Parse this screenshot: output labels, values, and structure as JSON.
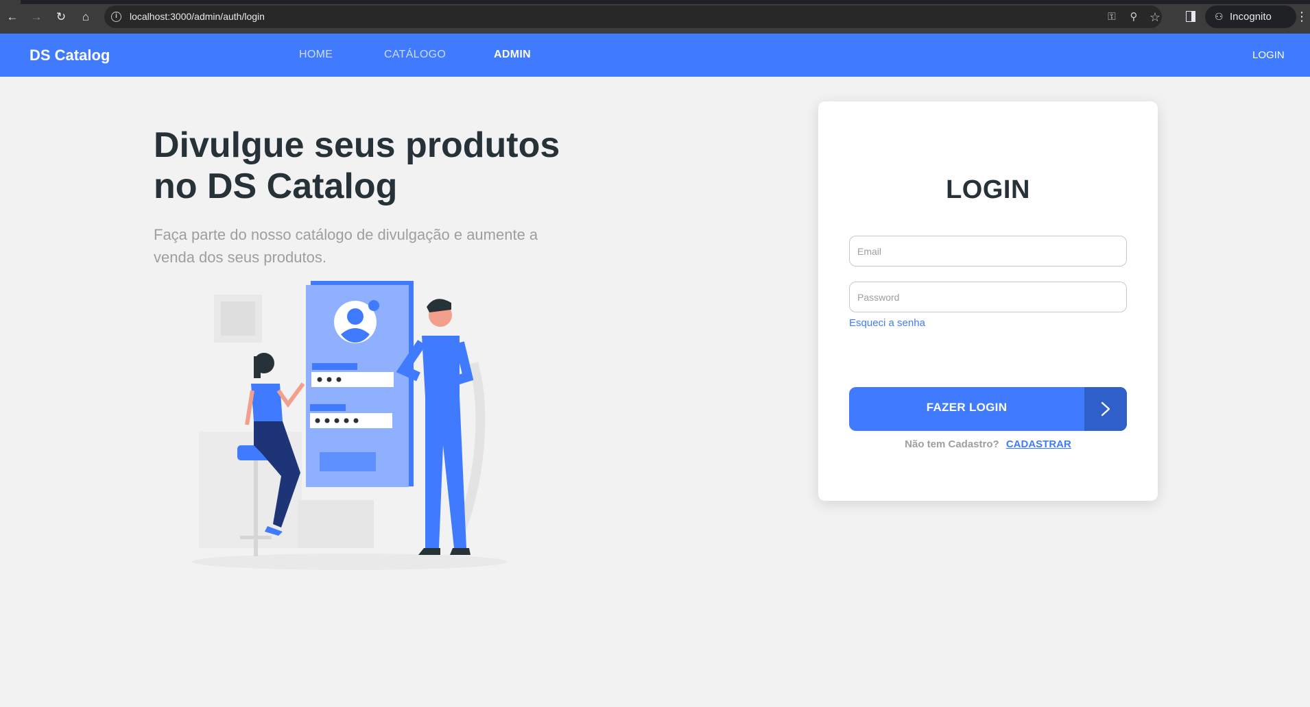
{
  "browser": {
    "url": "localhost:3000/admin/auth/login",
    "incognito_label": "Incognito",
    "icons": [
      "back-icon",
      "forward-icon",
      "reload-icon",
      "home-icon",
      "info-icon",
      "key-icon",
      "zoom-icon",
      "star-icon",
      "side-panel-icon",
      "incognito-icon",
      "menu-icon"
    ]
  },
  "navbar": {
    "brand": "DS Catalog",
    "links": [
      {
        "label": "HOME",
        "active": false
      },
      {
        "label": "CATÁLOGO",
        "active": false
      },
      {
        "label": "ADMIN",
        "active": true
      }
    ],
    "login": "LOGIN",
    "color": "#407bff"
  },
  "hero": {
    "title": "Divulgue seus produtos no DS Catalog",
    "subtitle": "Faça parte do nosso catálogo de divulgação e aumente a venda dos seus produtos."
  },
  "login_card": {
    "title": "LOGIN",
    "email_placeholder": "Email",
    "email_value": "",
    "password_placeholder": "Password",
    "password_value": "",
    "forgot": "Esqueci a senha",
    "submit": "FAZER LOGIN",
    "signup_question": "Não tem Cadastro?",
    "signup_link": "CADASTRAR"
  },
  "colors": {
    "primary": "#407bff",
    "primary_dark": "#2f5fc9",
    "text_dark": "#263238",
    "text_muted": "#9e9e9e",
    "background": "#f2f2f2"
  }
}
